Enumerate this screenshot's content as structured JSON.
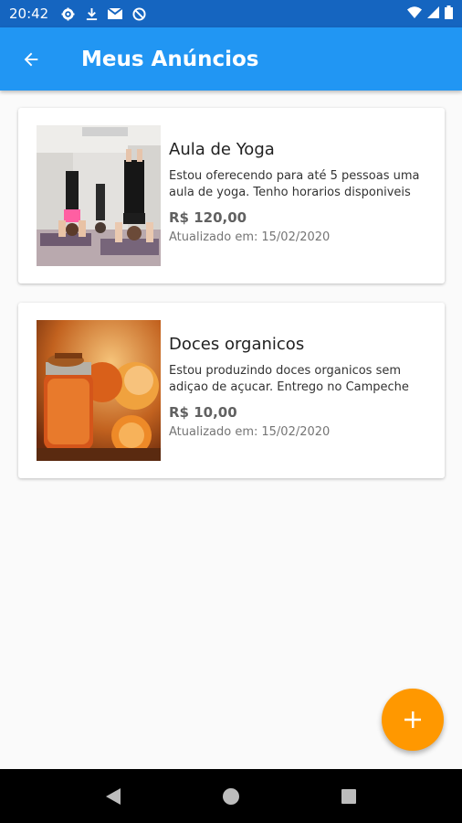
{
  "status_bar": {
    "time": "20:42",
    "icons": [
      "settings-icon",
      "download-icon",
      "gmail-icon",
      "blocked-icon",
      "wifi-icon",
      "signal-icon",
      "battery-icon"
    ]
  },
  "app_bar": {
    "title": "Meus Anúncios",
    "background": "#2196f3",
    "back_icon": "arrow-back-icon"
  },
  "ads": [
    {
      "title": "Aula de Yoga",
      "description": "Estou oferecendo para até 5 pessoas uma aula de yoga. Tenho horarios disponiveis",
      "price": "R$ 120,00",
      "updated_label": "Atualizado em:",
      "updated_date": "15/02/2020",
      "image": "yoga-class-photo"
    },
    {
      "title": "Doces organicos",
      "description": "Estou produzindo doces organicos sem adiçao de açucar. Entrego no Campeche",
      "price": "R$ 10,00",
      "updated_label": "Atualizado em:",
      "updated_date": "15/02/2020",
      "image": "orange-jam-photo"
    }
  ],
  "fab": {
    "icon": "add-icon",
    "color": "#ff9800"
  },
  "nav_bar": {
    "icons": [
      "back-triangle-icon",
      "home-circle-icon",
      "recents-square-icon"
    ]
  }
}
